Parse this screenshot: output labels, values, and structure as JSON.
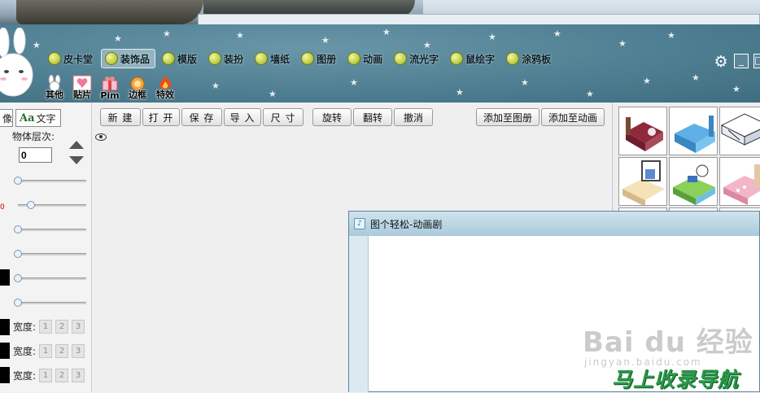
{
  "banner": {
    "nav": [
      {
        "label": "皮卡堂"
      },
      {
        "label": "装饰品",
        "active": true
      },
      {
        "label": "模版"
      },
      {
        "label": "装扮"
      },
      {
        "label": "墙纸"
      },
      {
        "label": "图册"
      },
      {
        "label": "动画"
      },
      {
        "label": "流光字"
      },
      {
        "label": "鼠绘字"
      },
      {
        "label": "涂鸦板"
      }
    ],
    "subnav": [
      {
        "label": "其他",
        "icon": "bunny-icon"
      },
      {
        "label": "贴片",
        "icon": "heart-card-icon"
      },
      {
        "label": "Pim",
        "icon": "gift-icon"
      },
      {
        "label": "边框",
        "icon": "frame-icon"
      },
      {
        "label": "特效",
        "icon": "fire-icon"
      }
    ],
    "window_controls": {
      "minimize": "_",
      "maximize": "□"
    }
  },
  "left_panel": {
    "tab_image": "像",
    "tab_text_icon": "Aa",
    "tab_text": "文字",
    "layer_label": "物体层次:",
    "layer_value": "0",
    "sliders": [
      0.0,
      0.15,
      0.0,
      0.0,
      0.0,
      0.0
    ],
    "width_label": "宽度:",
    "width_options": [
      "1",
      "2",
      "3"
    ]
  },
  "toolbar": {
    "group1": [
      "新 建",
      "打 开",
      "保 存",
      "导 入",
      "尺 寸"
    ],
    "group2": [
      "旋转",
      "翻转",
      "撤消"
    ],
    "group3": [
      "添加至图册",
      "添加至动画"
    ]
  },
  "popup": {
    "title": "图个轻松-动画剧"
  },
  "watermark": {
    "brand": "Bai du 经验",
    "sub": "jingyan.baidu.com",
    "logo": "马上收录导航"
  },
  "colors": {
    "banner": "#4f7f92",
    "accent_green": "#2a9a4a"
  }
}
